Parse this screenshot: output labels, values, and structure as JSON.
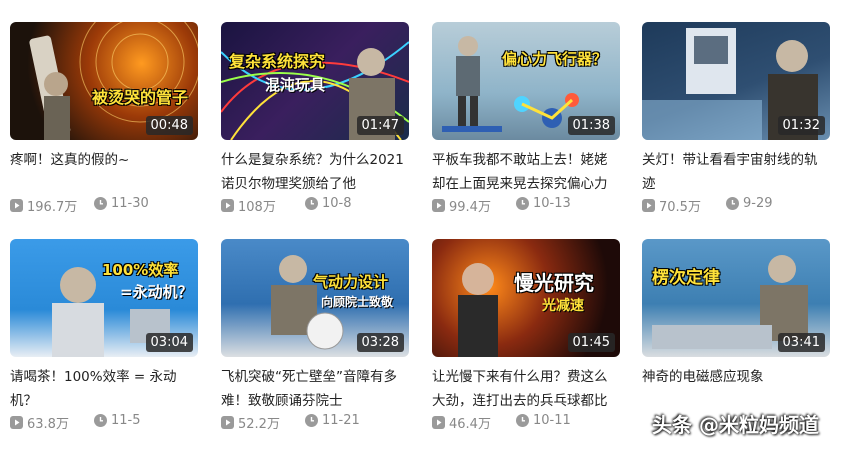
{
  "videos": [
    {
      "overlay": "被烫哭的管子",
      "sub": "",
      "duration": "00:48",
      "title": "疼啊！这真的假的~",
      "views": "196.7万",
      "date": "11-30",
      "bg": "#3a2314",
      "accent": "#f39a22"
    },
    {
      "overlay": "复杂系统探究",
      "sub": "混沌玩具",
      "duration": "01:47",
      "title": "什么是复杂系统？为什么2021诺贝尔物理奖颁给了他",
      "views": "108万",
      "date": "10-8",
      "bg": "#24203f",
      "accent": "#ff3b3b"
    },
    {
      "overlay": "偏心力飞行器？",
      "sub": "",
      "duration": "01:38",
      "title": "平板车我都不敢站上去！姥姥却在上面晃来晃去探究偏心力",
      "views": "99.4万",
      "date": "10-13",
      "bg": "#8fb4c9",
      "accent": "#4fd4ff"
    },
    {
      "overlay": "",
      "sub": "",
      "duration": "01:32",
      "title": "关灯！带让看看宇宙射线的轨迹",
      "views": "70.5万",
      "date": "9-29",
      "bg": "#2f4f72",
      "accent": "#9cc7e8"
    },
    {
      "overlay": "100%效率",
      "sub": "=永动机？",
      "duration": "03:04",
      "title": "请喝茶！100%效率 = 永动机？",
      "views": "63.8万",
      "date": "11-5",
      "bg": "#2a8ad8",
      "accent": "#ffe23a"
    },
    {
      "overlay": "气动力设计",
      "sub": "向顾院士致敬",
      "duration": "03:28",
      "title": "飞机突破“死亡壁垒”音障有多难！致敬顾诵芬院士",
      "views": "52.2万",
      "date": "11-21",
      "bg": "#2f6fb0",
      "accent": "#f5c04a"
    },
    {
      "overlay": "慢光研究",
      "sub": "光减速",
      "duration": "01:45",
      "title": "让光慢下来有什么用？费这么大劲，连打出去的兵乓球都比",
      "views": "46.4万",
      "date": "10-11",
      "bg": "#3a1410",
      "accent": "#ff8a1a"
    },
    {
      "overlay": "楞次定律",
      "sub": "",
      "duration": "03:41",
      "title": "神奇的电磁感应现象",
      "views": "",
      "date": "",
      "bg": "#3d7fb2",
      "accent": "#ffe23a"
    }
  ],
  "watermark": "头条 @米粒妈频道",
  "icons": {
    "views": "play-icon",
    "date": "clock-icon"
  }
}
